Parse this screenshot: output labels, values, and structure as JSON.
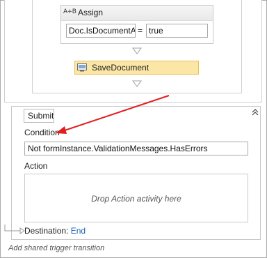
{
  "assign": {
    "title": "Assign",
    "icon": "assign-icon",
    "icon_text": "A+B",
    "to": "Doc.IsDocumentAc",
    "operator": "=",
    "value": "true"
  },
  "save_document": {
    "label": "SaveDocument",
    "icon": "activity-icon",
    "background": "#fbe6a6",
    "border": "#e6c35a"
  },
  "transition": {
    "trigger": "Submit",
    "condition_label": "Condition",
    "condition_value": "Not formInstance.ValidationMessages.HasErrors",
    "action_label": "Action",
    "action_placeholder": "Drop Action activity here",
    "destination_label": "Destination:",
    "destination_value": "End",
    "collapse_icon": "double-chevron-up-icon"
  },
  "footer": {
    "add_shared_trigger": "Add shared trigger transition"
  },
  "colors": {
    "annotation_arrow": "#e02020",
    "link": "#1a5fb4"
  }
}
